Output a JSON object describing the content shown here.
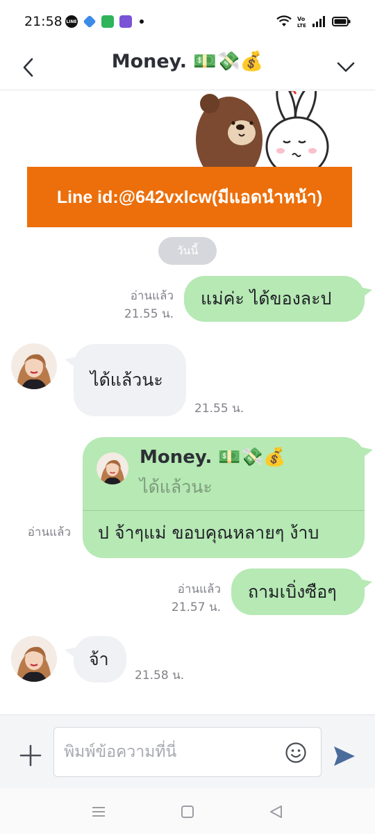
{
  "status_bar": {
    "time": "21:58",
    "icons": [
      "line-app-icon",
      "app-icon-blue",
      "app-icon-green",
      "app-icon-purple",
      "notification-dot",
      "wifi-icon",
      "volte-icon",
      "signal-icon",
      "battery-icon"
    ]
  },
  "header": {
    "title": "Money. 💵💸💰",
    "back_icon": "chevron-left-icon",
    "menu_icon": "chevron-down-icon"
  },
  "promo_banner": {
    "text": "Line id:@642vxlcw(มีแอดนำหน้า)",
    "color": "#ec6f0b"
  },
  "date_separator": "วันนี้",
  "messages": [
    {
      "direction": "out",
      "text": "แม่ค่ะ ได้ของละป",
      "read": "อ่านแล้ว",
      "time": "21.55 น."
    },
    {
      "direction": "in",
      "text": "ได้แล้วนะ",
      "time": "21.55 น."
    },
    {
      "direction": "out",
      "reply_to": {
        "name": "Money. 💵💸💰",
        "text": "ได้แล้วนะ"
      },
      "text": "ป จ้าๆแม่ ขอบคุณหลายๆ ง้าบ",
      "read": "อ่านแล้ว"
    },
    {
      "direction": "out",
      "text": "ถามเบิ่งซือๆ",
      "read": "อ่านแล้ว",
      "time": "21.57 น."
    },
    {
      "direction": "in",
      "text": "จ้า",
      "time": "21.58 น."
    }
  ],
  "input": {
    "placeholder": "พิมพ์ข้อความที่นี่"
  },
  "colors": {
    "outgoing_bubble": "#b6e9b4",
    "incoming_bubble": "#f0f1f4",
    "send_icon": "#4a6c9b"
  }
}
